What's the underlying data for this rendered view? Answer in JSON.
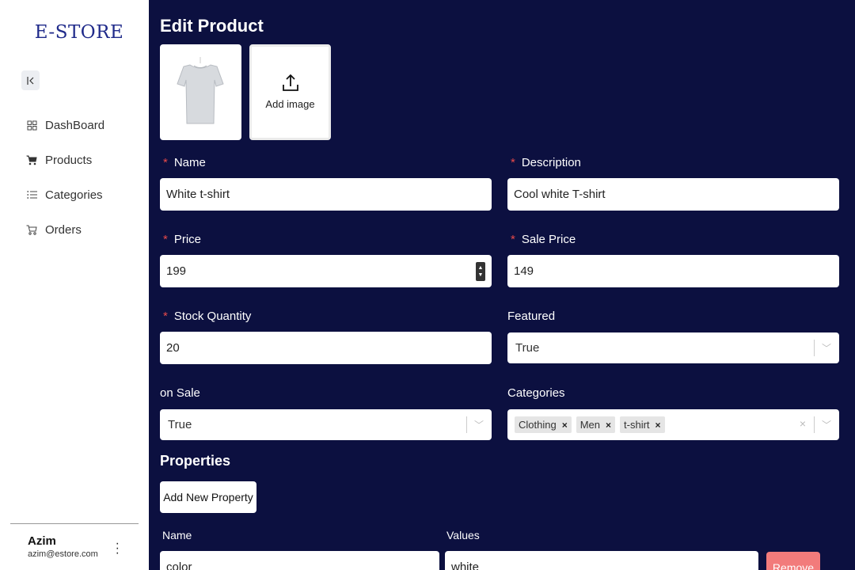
{
  "brand": {
    "logo": "E-STORE"
  },
  "sidebar": {
    "items": [
      {
        "label": "DashBoard",
        "icon": "dashboard-grid-icon"
      },
      {
        "label": "Products",
        "icon": "cart-icon"
      },
      {
        "label": "Categories",
        "icon": "list-icon"
      },
      {
        "label": "Orders",
        "icon": "orders-cart-icon"
      }
    ],
    "user": {
      "name": "Azim",
      "email": "azim@estore.com"
    }
  },
  "page": {
    "title": "Edit Product"
  },
  "images": {
    "add_label": "Add image"
  },
  "form": {
    "name": {
      "label": "Name",
      "value": "White t-shirt"
    },
    "description": {
      "label": "Description",
      "value": "Cool white T-shirt"
    },
    "price": {
      "label": "Price",
      "value": "199"
    },
    "sale_price": {
      "label": "Sale Price",
      "value": "149"
    },
    "stock": {
      "label": "Stock Quantity",
      "value": "20"
    },
    "featured": {
      "label": "Featured",
      "value": "True"
    },
    "on_sale": {
      "label": "on Sale",
      "value": "True"
    },
    "categories": {
      "label": "Categories",
      "selected": [
        "Clothing",
        "Men",
        "t-shirt"
      ]
    }
  },
  "properties": {
    "title": "Properties",
    "add_button": "Add New Property",
    "name_label": "Name",
    "values_label": "Values",
    "rows": [
      {
        "name": "color",
        "values": "white",
        "remove": "Remove"
      }
    ]
  },
  "colors": {
    "background": "#0c1040",
    "remove": "#f27b7b",
    "required": "#e84a4a"
  }
}
